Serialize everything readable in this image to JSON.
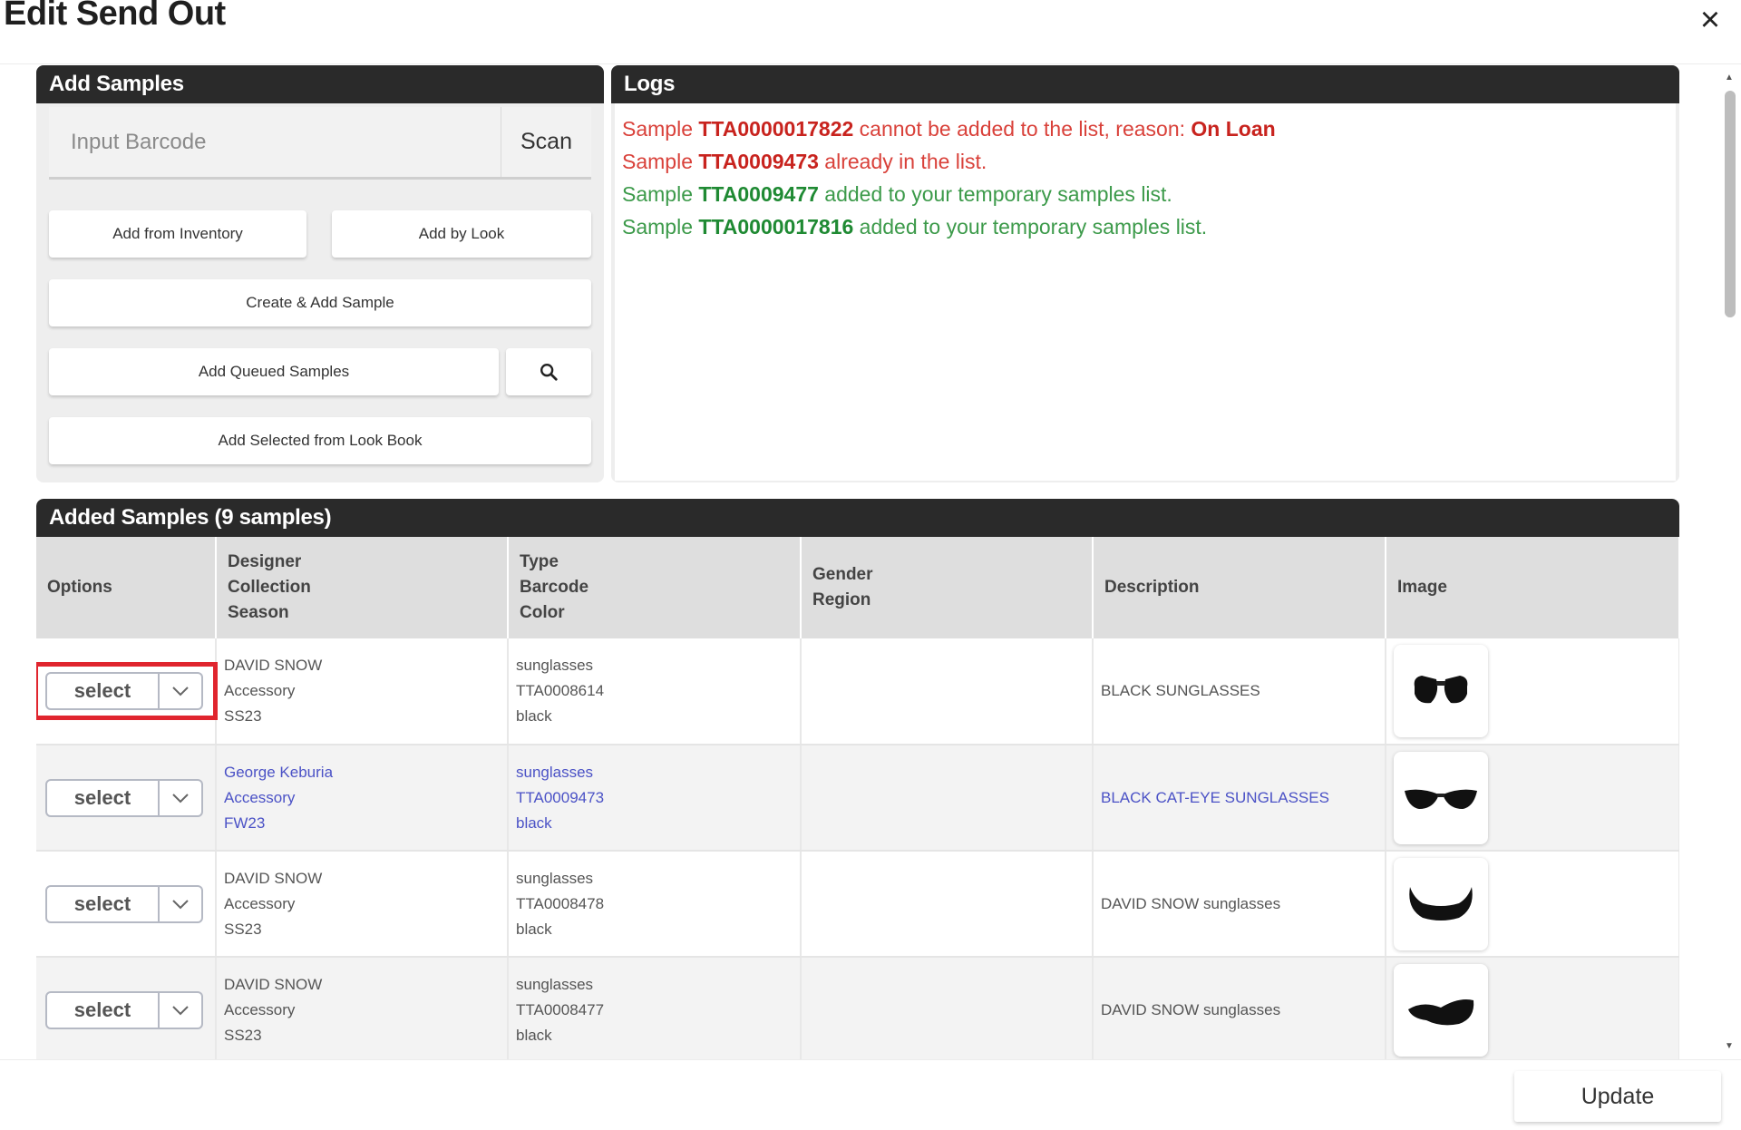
{
  "modal": {
    "title": "Edit Send Out",
    "close": "×"
  },
  "add_samples": {
    "header": "Add Samples",
    "barcode_placeholder": "Input Barcode",
    "scan_label": "Scan",
    "add_from_inventory": "Add from Inventory",
    "add_by_look": "Add by Look",
    "create_add_sample": "Create & Add Sample",
    "add_queued_samples": "Add Queued Samples",
    "add_selected_look_book": "Add Selected from Look Book"
  },
  "logs": {
    "header": "Logs",
    "lines": [
      {
        "pre": "Sample ",
        "code": "TTA0000017822",
        "mid": " cannot be added to the list, reason: ",
        "reason": "On Loan",
        "status": "error"
      },
      {
        "pre": "Sample ",
        "code": "TTA0009473",
        "mid": " already in the list.",
        "reason": "",
        "status": "error"
      },
      {
        "pre": "Sample ",
        "code": "TTA0009477",
        "mid": " added to your temporary samples list.",
        "reason": "",
        "status": "ok"
      },
      {
        "pre": "Sample ",
        "code": "TTA0000017816",
        "mid": " added to your temporary samples list.",
        "reason": "",
        "status": "ok"
      }
    ]
  },
  "added_samples": {
    "header": "Added Samples (9 samples)",
    "columns": [
      {
        "lines": [
          "Options"
        ]
      },
      {
        "lines": [
          "Designer",
          "Collection",
          "Season"
        ]
      },
      {
        "lines": [
          "Type",
          "Barcode",
          "Color"
        ]
      },
      {
        "lines": [
          "Gender",
          "Region"
        ]
      },
      {
        "lines": [
          "Description"
        ]
      },
      {
        "lines": [
          "Image"
        ]
      }
    ],
    "select_label": "select",
    "rows": [
      {
        "designer": "DAVID SNOW",
        "collection": "Accessory",
        "season": "SS23",
        "type": "sunglasses",
        "barcode": "TTA0008614",
        "color": "black",
        "description": "BLACK SUNGLASSES"
      },
      {
        "designer": "George Keburia",
        "collection": "Accessory",
        "season": "FW23",
        "type": "sunglasses",
        "barcode": "TTA0009473",
        "color": "black",
        "description": "BLACK CAT-EYE SUNGLASSES"
      },
      {
        "designer": "DAVID SNOW",
        "collection": "Accessory",
        "season": "SS23",
        "type": "sunglasses",
        "barcode": "TTA0008478",
        "color": "black",
        "description": "DAVID SNOW sunglasses"
      },
      {
        "designer": "DAVID SNOW",
        "collection": "Accessory",
        "season": "SS23",
        "type": "sunglasses",
        "barcode": "TTA0008477",
        "color": "black",
        "description": "DAVID SNOW sunglasses"
      }
    ]
  },
  "footer": {
    "update_label": "Update"
  },
  "colors": {
    "header_bg": "#2a2a2a",
    "error": "#d9413a",
    "success": "#3c9a4a",
    "link": "#4b52c6",
    "highlight": "#e0252e"
  }
}
